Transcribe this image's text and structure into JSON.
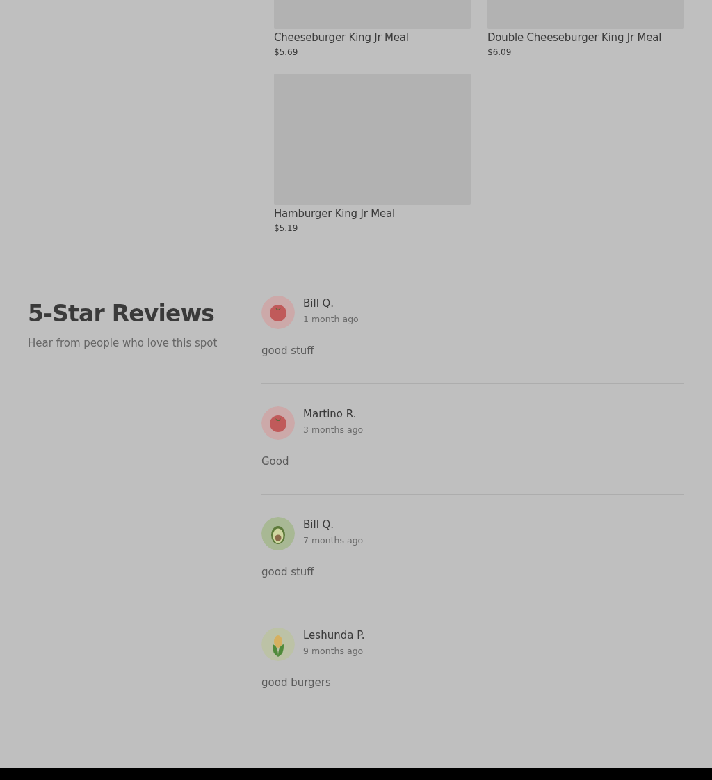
{
  "menu_items": [
    {
      "name": "Cheeseburger King Jr Meal",
      "price": "$5.69"
    },
    {
      "name": "Double Cheeseburger King Jr Meal",
      "price": "$6.09"
    },
    {
      "name": "Hamburger King Jr Meal",
      "price": "$5.19"
    }
  ],
  "reviews_section": {
    "title": "5-Star Reviews",
    "subtitle": "Hear from people who love this spot"
  },
  "reviews": [
    {
      "author": "Bill Q.",
      "time": "1 month ago",
      "text": "good stuff",
      "kind": "tomato"
    },
    {
      "author": "Martino R.",
      "time": "3 months ago",
      "text": "Good",
      "kind": "tomato"
    },
    {
      "author": "Bill Q.",
      "time": "7 months ago",
      "text": "good stuff",
      "kind": "avocado"
    },
    {
      "author": "Leshunda P.",
      "time": "9 months ago",
      "text": "good burgers",
      "kind": "corn"
    }
  ]
}
